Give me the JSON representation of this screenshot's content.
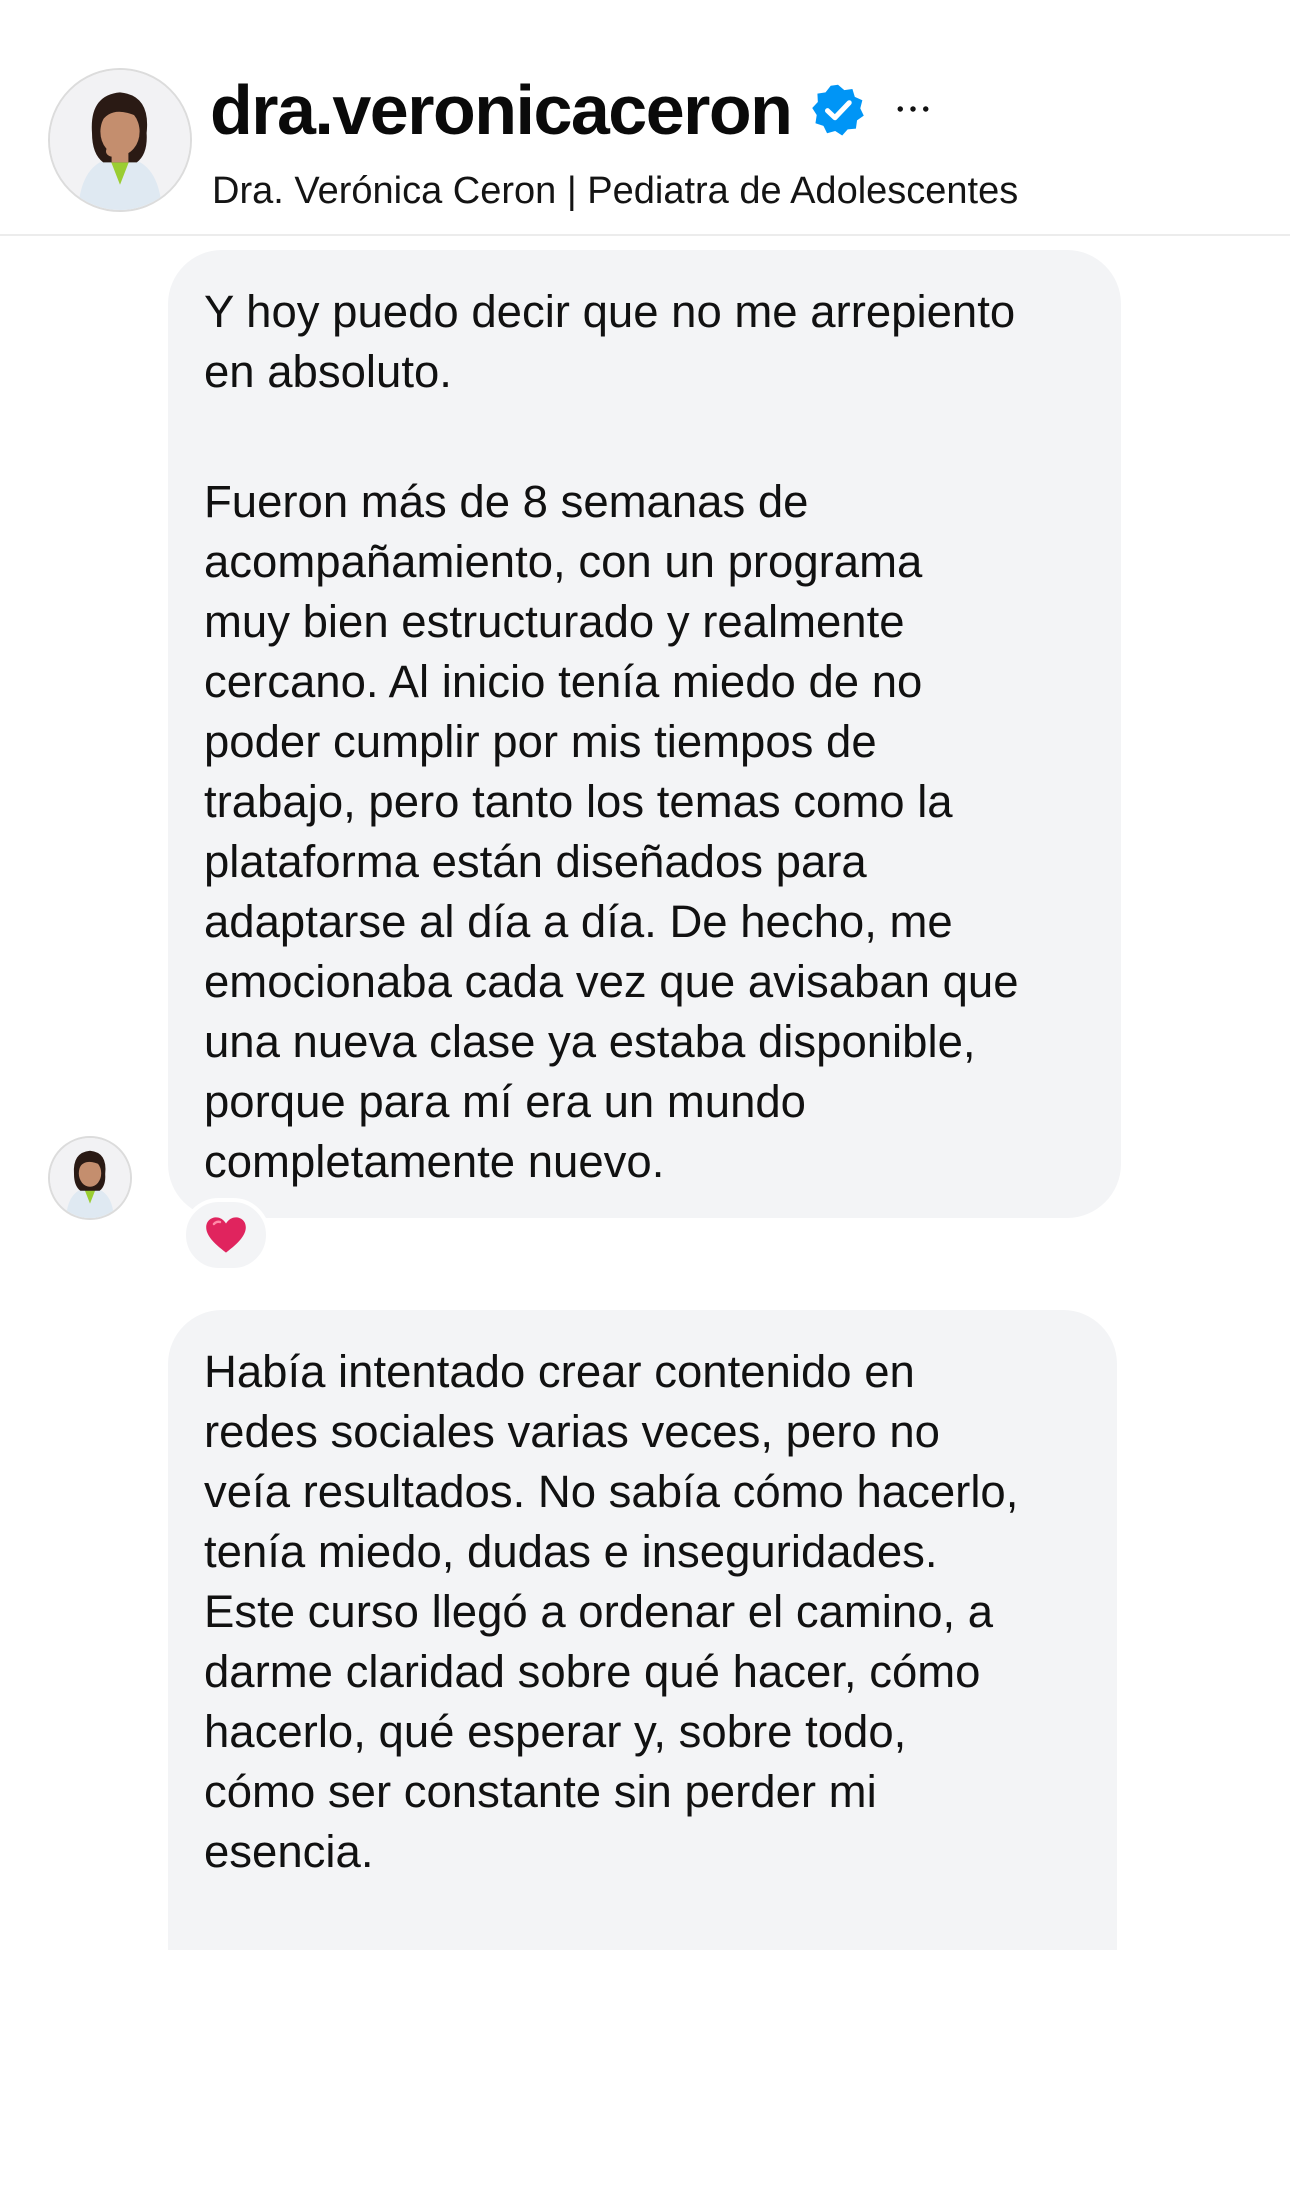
{
  "header": {
    "username": "dra.veronicaceron",
    "subtitle": "Dra. Verónica Ceron | Pediatra de Adolescentes",
    "verified_icon": "verified-badge-icon",
    "more_icon": "more-options-icon",
    "more_symbol": "···",
    "avatar_icon": "profile-avatar"
  },
  "messages": [
    {
      "paragraphs": [
        "Y hoy puedo decir que no me arrepiento\nen absoluto.",
        "Fueron más de 8 semanas de\nacompañamiento, con un programa\nmuy bien estructurado y realmente\ncercano. Al inicio tenía miedo de no\npoder cumplir por mis tiempos de\ntrabajo, pero tanto los temas como la\nplataforma están diseñados para\nadaptarse al día a día. De hecho, me\nemocionaba cada vez que avisaban que\nuna nueva clase ya estaba disponible,\nporque para mí era un mundo\ncompletamente nuevo."
      ],
      "reaction": "❤️",
      "reaction_icon": "heart-icon"
    },
    {
      "paragraphs": [
        "Había intentado crear contenido en\nredes sociales varias veces, pero no\nveía resultados. No sabía cómo hacerlo,\ntenía miedo, dudas e inseguridades.\nEste curso llegó a ordenar el camino, a\ndarme claridad sobre qué hacer, cómo\nhacerlo, qué esperar y, sobre todo,\ncómo ser constante sin perder mi\nesencia."
      ]
    }
  ],
  "colors": {
    "bubble": "#f3f4f6",
    "verified": "#0095f6",
    "text": "#0a0a0a",
    "heart": "#e0245e"
  }
}
